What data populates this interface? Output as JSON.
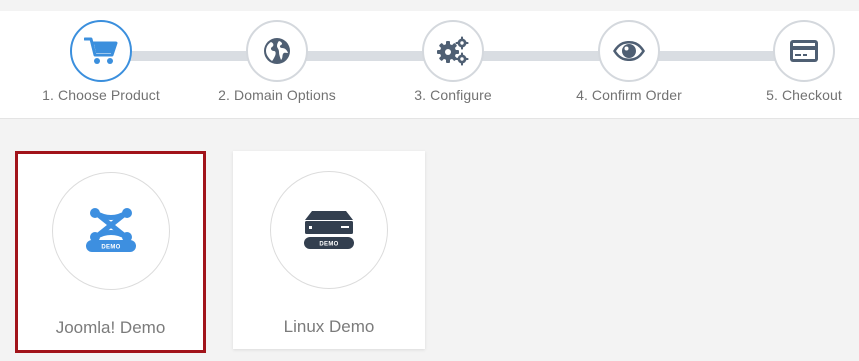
{
  "steps": [
    {
      "label": "1. Choose Product",
      "icon": "cart-icon",
      "active": true
    },
    {
      "label": "2. Domain Options",
      "icon": "globe-icon",
      "active": false
    },
    {
      "label": "3. Configure",
      "icon": "gears-icon",
      "active": false
    },
    {
      "label": "4. Confirm Order",
      "icon": "eye-icon",
      "active": false
    },
    {
      "label": "5. Checkout",
      "icon": "credit-card-icon",
      "active": false
    }
  ],
  "products": [
    {
      "name": "Joomla! Demo",
      "badge": "DEMO",
      "icon": "joomla-icon",
      "selected": true
    },
    {
      "name": "Linux Demo",
      "badge": "DEMO",
      "icon": "server-icon",
      "selected": false
    }
  ],
  "colors": {
    "accent": "#3b8fdd",
    "step_icon": "#4f5f73",
    "selected_border": "#a1131a",
    "joomla_blue": "#3d8fe0",
    "server_dark": "#333f4f"
  }
}
